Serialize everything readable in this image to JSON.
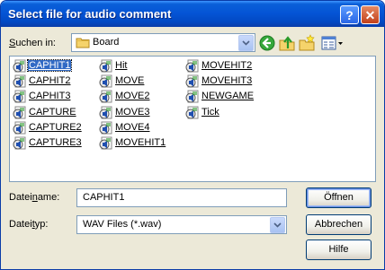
{
  "window": {
    "title": "Select file for audio comment",
    "help": "?",
    "close": "✕"
  },
  "lookin": {
    "label": "Suchen in:",
    "value": "Board"
  },
  "files": [
    "CAPHIT1",
    "CAPHIT2",
    "CAPHIT3",
    "CAPTURE",
    "CAPTURE2",
    "CAPTURE3",
    "Hit",
    "MOVE",
    "MOVE2",
    "MOVE3",
    "MOVE4",
    "MOVEHIT1",
    "MOVEHIT2",
    "MOVEHIT3",
    "NEWGAME",
    "Tick"
  ],
  "selected": "CAPHIT1",
  "filename": {
    "label": "Dateiname:",
    "value": "CAPHIT1"
  },
  "filetype": {
    "label": "Dateityp:",
    "value": "WAV Files (*.wav)"
  },
  "buttons": {
    "open": "Öffnen",
    "cancel": "Abbrechen",
    "help": "Hilfe"
  },
  "icons": [
    "back-icon",
    "up-folder-icon",
    "new-folder-icon",
    "view-menu-icon",
    "folder-icon",
    "wav-file-icon"
  ]
}
